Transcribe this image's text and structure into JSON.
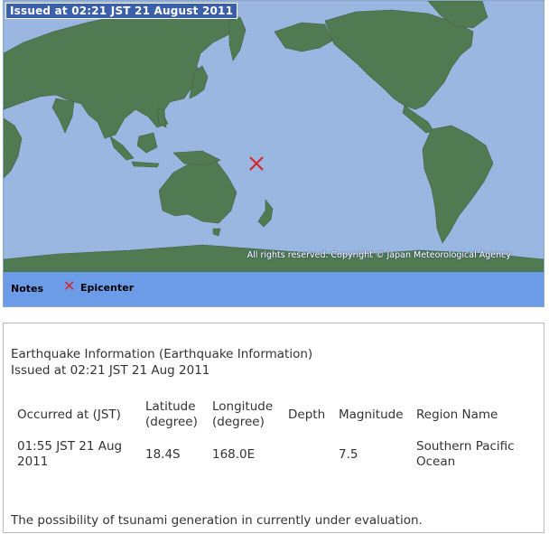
{
  "map": {
    "issued_label": "Issued at 02:21 JST  21 August 2011",
    "copyright": "All rights reserved. Copyright © Japan Meteorological Agency",
    "ocean_color": "#9bb8e2",
    "land_color": "#4f7a52",
    "epicenter_marker_color": "#d42828",
    "epicenter": {
      "latitude": -18.4,
      "longitude": 168.0
    }
  },
  "legend": {
    "notes_label": "Notes",
    "epicenter_symbol": "✕",
    "epicenter_label": "Epicenter"
  },
  "info": {
    "title": "Earthquake Information (Earthquake Information)",
    "issued": "Issued at 02:21 JST 21 Aug 2011",
    "columns": {
      "occurred": "Occurred at (JST)",
      "latitude": "Latitude (degree)",
      "longitude": "Longitude (degree)",
      "depth": "Depth",
      "magnitude": "Magnitude",
      "region": "Region Name"
    },
    "row": {
      "occurred": "01:55 JST 21 Aug 2011",
      "latitude": "18.4S",
      "longitude": "168.0E",
      "depth": "",
      "magnitude": "7.5",
      "region": "Southern Pacific Ocean"
    },
    "note": "The possibility of tsunami generation in currently under evaluation."
  }
}
